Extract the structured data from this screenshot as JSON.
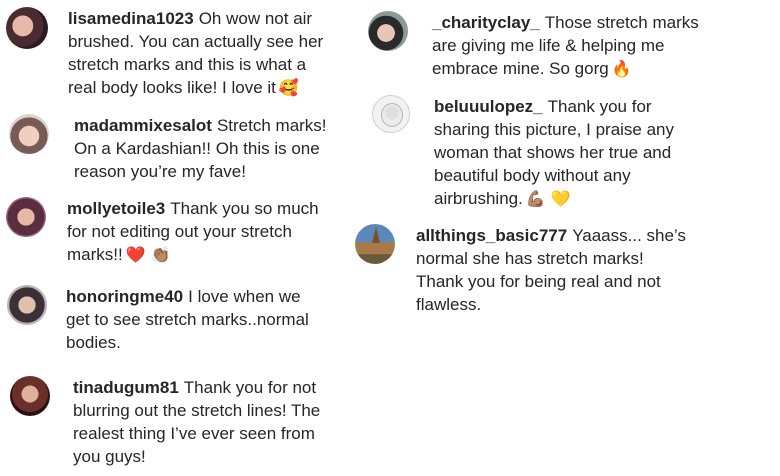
{
  "comments": [
    {
      "username": "lisamedina1023",
      "text": "Oh wow not air brushed. You can actually see her stretch marks and this is what a real body looks like! I love it",
      "emoji": "🥰",
      "avatar_icon": "profile-avatar"
    },
    {
      "username": "madammixesalot",
      "text": "Stretch marks! On a Kardashian!! Oh this is one reason you’re my fave!",
      "emoji": "",
      "avatar_icon": "profile-avatar"
    },
    {
      "username": "mollyetoile3",
      "text": "Thank you so much for not editing out your stretch marks!!",
      "emoji": "❤️ 👏🏽",
      "avatar_icon": "profile-avatar"
    },
    {
      "username": "honoringme40",
      "text": "I love when we get to see stretch marks..normal bodies.",
      "emoji": "",
      "avatar_icon": "profile-avatar"
    },
    {
      "username": "tinadugum81",
      "text": "Thank you for not blurring out the stretch lines! The realest thing I’ve ever seen from you guys!",
      "emoji": "",
      "avatar_icon": "profile-avatar"
    },
    {
      "username": "_charityclay_",
      "text": "Those stretch marks are giving me life & helping me embrace mine. So gorg",
      "emoji": "🔥",
      "avatar_icon": "profile-avatar"
    },
    {
      "username": "beluuulopez_",
      "text": "Thank you for sharing this picture, I praise any woman that shows her true and beautiful body without any airbrushing.",
      "emoji": "💪🏽 💛",
      "avatar_icon": "default-avatar"
    },
    {
      "username": "allthings_basic777",
      "text": "Yaaass... she’s normal she has stretch marks! Thank you for being real and not flawless.",
      "emoji": "",
      "avatar_icon": "profile-avatar"
    }
  ]
}
